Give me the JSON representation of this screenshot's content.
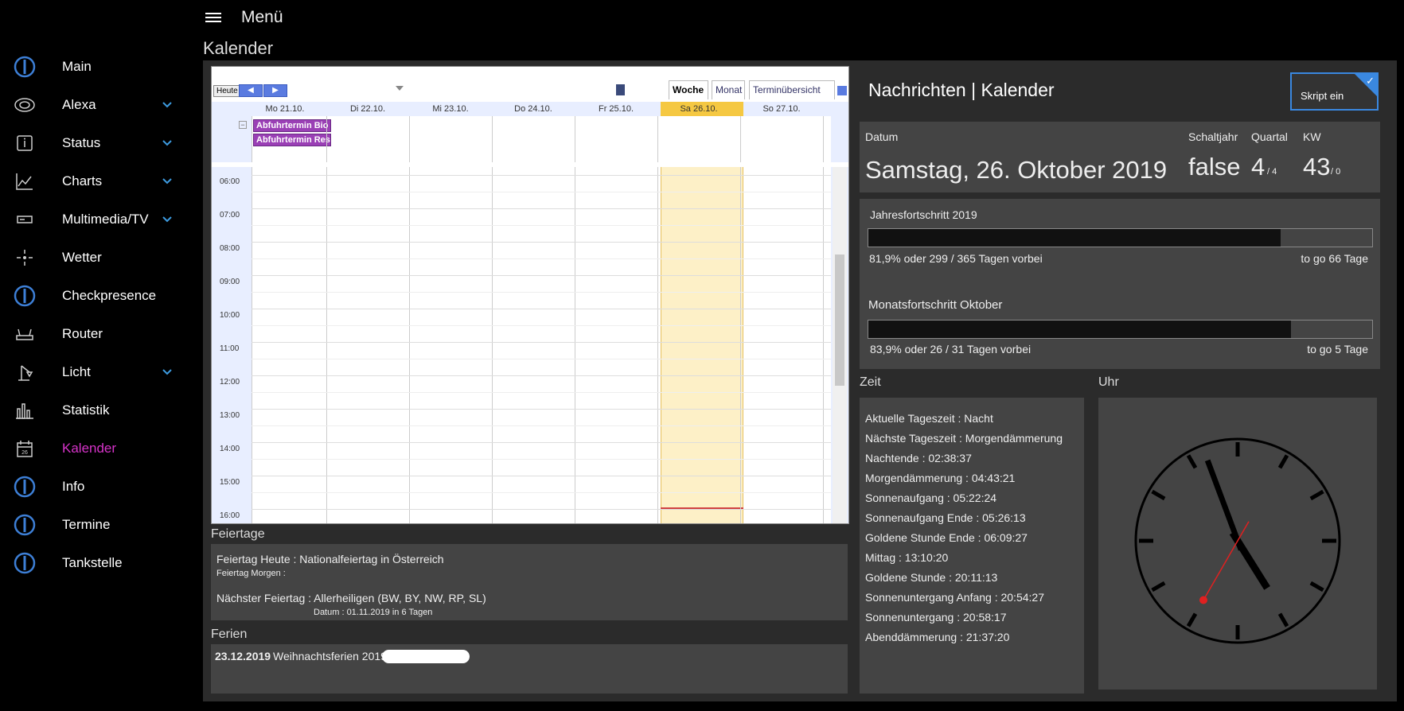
{
  "topbar": {
    "menu_title": "Menü",
    "page_title": "Kalender"
  },
  "sidebar": {
    "items": [
      {
        "label": "Main",
        "icon": "iobroker-logo-icon",
        "chevron": false
      },
      {
        "label": "Alexa",
        "icon": "echo-speaker-icon",
        "chevron": true
      },
      {
        "label": "Status",
        "icon": "info-square-icon",
        "chevron": true
      },
      {
        "label": "Charts",
        "icon": "line-chart-icon",
        "chevron": true
      },
      {
        "label": "Multimedia/TV",
        "icon": "tv-box-icon",
        "chevron": true
      },
      {
        "label": "Wetter",
        "icon": "sun-icon",
        "chevron": false
      },
      {
        "label": "Checkpresence",
        "icon": "iobroker-logo-icon",
        "chevron": false
      },
      {
        "label": "Router",
        "icon": "router-icon",
        "chevron": false
      },
      {
        "label": "Licht",
        "icon": "lamp-icon",
        "chevron": true
      },
      {
        "label": "Statistik",
        "icon": "bar-chart-icon",
        "chevron": false
      },
      {
        "label": "Kalender",
        "icon": "calendar-icon",
        "chevron": false,
        "active": true
      },
      {
        "label": "Info",
        "icon": "iobroker-logo-icon",
        "chevron": false
      },
      {
        "label": "Termine",
        "icon": "iobroker-logo-icon",
        "chevron": false
      },
      {
        "label": "Tankstelle",
        "icon": "iobroker-logo-icon",
        "chevron": false
      }
    ],
    "active_color": "#d633c9"
  },
  "calendar": {
    "today_button": "Heute",
    "tabs": [
      "Woche",
      "Monat",
      "Terminübersicht"
    ],
    "days": [
      "Mo 21.10.",
      "Di 22.10.",
      "Mi 23.10.",
      "Do 24.10.",
      "Fr 25.10.",
      "Sa 26.10.",
      "So 27.10."
    ],
    "allday_events": [
      "Abfuhrtermin Bio",
      "Abfuhrtermin Res"
    ],
    "hours": [
      "06:00",
      "07:00",
      "08:00",
      "09:00",
      "10:00",
      "11:00",
      "12:00",
      "13:00",
      "14:00",
      "15:00",
      "16:00"
    ],
    "collapse_symbol": "−",
    "arrow_prev": "◀",
    "arrow_next": "▶"
  },
  "feiertage": {
    "title": "Feiertage",
    "heute": "Feiertag Heute : Nationalfeiertag in Österreich",
    "morgen": "Feiertag Morgen :",
    "naechster": "Nächster Feiertag : Allerheiligen (BW, BY, NW, RP, SL)",
    "datum": "Datum : 01.11.2019  in 6 Tagen"
  },
  "ferien": {
    "title": "Ferien",
    "date": "23.12.2019",
    "name": "Weihnachtsferien 2019"
  },
  "news": {
    "title": "Nachrichten | Kalender",
    "script_button": "Skript ein",
    "datum_label": "Datum",
    "datum_value": "Samstag, 26. Oktober 2019",
    "schaltjahr_label": "Schaltjahr",
    "schaltjahr_value": "false",
    "quartal_label": "Quartal",
    "quartal_value": "4",
    "quartal_total": "/ 4",
    "kw_label": "KW",
    "kw_value": "43",
    "kw_total": "/ 0"
  },
  "progress": {
    "year": {
      "title": "Jahresfortschritt 2019",
      "text": "81,9% oder 299 / 365 Tagen vorbei",
      "togo": "to go 66 Tage",
      "fraction": 0.819
    },
    "month": {
      "title": "Monatsfortschritt Oktober",
      "text": "83,9% oder 26 / 31 Tagen vorbei",
      "togo": "to go 5 Tage",
      "fraction": 0.839
    }
  },
  "zeit": {
    "title": "Zeit",
    "rows": [
      "Aktuelle Tageszeit : Nacht",
      "Nächste Tageszeit : Morgendämmerung",
      "Nachtende : 02:38:37",
      "Morgendämmerung : 04:43:21",
      "Sonnenaufgang : 05:22:24",
      "Sonnenaufgang Ende : 05:26:13",
      "Goldene Stunde Ende : 06:09:27",
      "Mittag : 13:10:20",
      "Goldene Stunde : 20:11:13",
      "Sonnenuntergang Anfang : 20:54:27",
      "Sonnenuntergang : 20:58:17",
      "Abenddämmerung : 21:37:20"
    ]
  },
  "uhr": {
    "title": "Uhr",
    "hour": 4,
    "minute": 56,
    "second": 35
  }
}
